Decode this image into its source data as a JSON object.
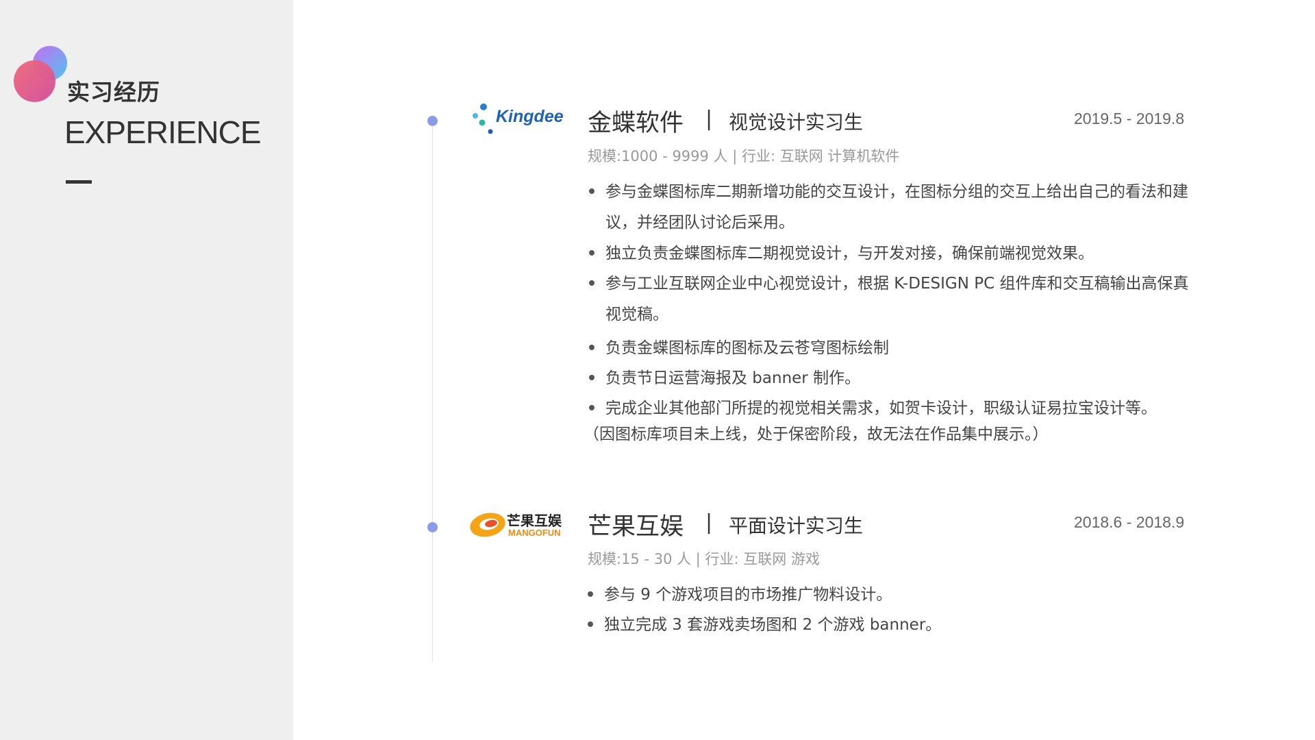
{
  "sidebar": {
    "title_cn": "实习经历",
    "title_en": "EXPERIENCE"
  },
  "experiences": [
    {
      "logo_text": "Kingdee",
      "company": "金蝶软件",
      "separator": "|",
      "role": "视觉设计实习生",
      "date": "2019.5 - 2019.8",
      "meta": "规模:1000 - 9999 人 | 行业: 互联网 计算机软件",
      "bullets": [
        "参与金蝶图标库二期新增功能的交互设计，在图标分组的交互上给出自己的看法和建议，并经团队讨论后采用。",
        "独立负责金蝶图标库二期视觉设计，与开发对接，确保前端视觉效果。",
        "参与工业互联网企业中心视觉设计，根据 K-DESIGN PC 组件库和交互稿输出高保真视觉稿。",
        "负责金蝶图标库的图标及云苍穹图标绘制",
        "负责节日运营海报及 banner 制作。",
        "完成企业其他部门所提的视觉相关需求，如贺卡设计，职级认证易拉宝设计等。"
      ],
      "note": "（因图标库项目未上线，处于保密阶段，故无法在作品集中展示。）"
    },
    {
      "logo_text_cn": "芒果互娱",
      "logo_text_en": "MANGOFUN",
      "company": "芒果互娱",
      "separator": "|",
      "role": "平面设计实习生",
      "date": "2018.6 - 2018.9",
      "meta": "规模:15 - 30 人 | 行业: 互联网 游戏",
      "bullets": [
        "参与 9 个游戏项目的市场推广物料设计。",
        "独立完成 3 套游戏卖场图和 2 个游戏 banner。"
      ]
    }
  ]
}
